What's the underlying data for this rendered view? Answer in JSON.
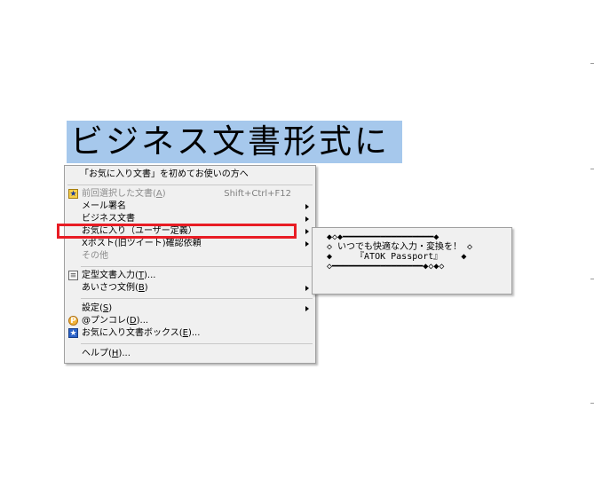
{
  "heading": {
    "text": "ビジネス文書形式に"
  },
  "menu": {
    "top_item": "「お気に入り文書」を初めてお使いの方へ",
    "items": [
      {
        "label": "前回選択した文書",
        "key": "A",
        "shortcut": "Shift+Ctrl+F12",
        "disabled": true,
        "icon": "recent-doc-icon"
      },
      {
        "label": "メール署名",
        "has_submenu": true
      },
      {
        "label": "ビジネス文書",
        "has_submenu": true
      },
      {
        "label": "お気に入り（ユーザー定義）",
        "has_submenu": true,
        "highlighted": true
      },
      {
        "label": "Xポスト(旧ツイート)確認依頼",
        "has_submenu": true
      },
      {
        "label": "その他",
        "disabled": true
      },
      {
        "label": "定型文書入力",
        "key": "T",
        "suffix": "...",
        "icon": "template-doc-icon"
      },
      {
        "label": "あいさつ文例",
        "key": "B",
        "has_submenu": true
      },
      {
        "label": "設定",
        "key": "S",
        "has_submenu": true
      },
      {
        "label": "@プンコレ",
        "key": "D",
        "suffix": "...",
        "icon": "punkore-icon"
      },
      {
        "label": "お気に入り文書ボックス",
        "key": "E",
        "suffix": "...",
        "icon": "favorites-box-icon"
      },
      {
        "label": "ヘルプ",
        "key": "H",
        "suffix": "..."
      }
    ]
  },
  "submenu": {
    "lines": [
      "◆◇◆━━━━━━━━━━━━━━━━━◆",
      "◇ いつでも快適な入力・変換を！ ◇",
      "◆　　 『ATOK Passport』　　 ◆",
      "◇━━━━━━━━━━━━━━━━━◆◇◆◇"
    ]
  },
  "colors": {
    "heading_bg": "#a6c8ec",
    "highlight_border": "#e81c24",
    "menu_bg": "#f0f0f0"
  }
}
